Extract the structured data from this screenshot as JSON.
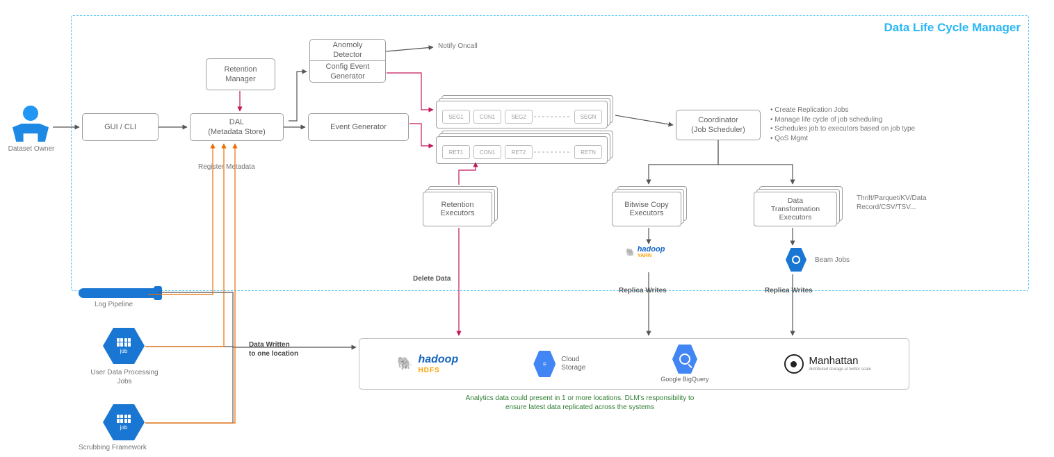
{
  "title": "Data Life Cycle Manager",
  "actor": "Dataset Owner",
  "boxes": {
    "gui": "GUI / CLI",
    "retention_mgr": "Retention\nManager",
    "dal": "DAL\n(Metadata Store)",
    "anomaly": "Anomoly\nDetector",
    "config_evt": "Config Event\nGenerator",
    "event_gen": "Event Generator",
    "coordinator": "Coordinator\n(Job Scheduler)",
    "ret_exec": "Retention\nExecutors",
    "bit_exec": "Bitwise Copy\nExecutors",
    "data_exec": "Data\nTransformation\nExecutors"
  },
  "mini": {
    "seg1": "SEG1",
    "con1": "CON1",
    "seg2": "SEG2",
    "segn": "SEGN",
    "ret1": "RET1",
    "con1b": "CON1",
    "ret2": "RET2",
    "retn": "RETN"
  },
  "labels": {
    "notify": "Notify Oncall",
    "register": "Register Metadata",
    "delete": "Delete Data",
    "replica1": "Replica Writes",
    "replica2": "Replica Writes",
    "beam": "Beam Jobs",
    "thrift": "Thrift/Parquet/KV/Data\nRecord/CSV/TSV...",
    "datawritten": "Data Written\nto one location",
    "logpipe": "Log Pipeline",
    "userjobs": "User Data Processing\nJobs",
    "scrubbing": "Scrubbing Framework",
    "footnote": "Analytics data could present in 1 or more locations. DLM's responsibility to\nensure latest data replicated across the systems",
    "job": "job"
  },
  "coord_bullets": [
    "Create Replication Jobs",
    "Manage life cycle of job scheduling",
    "Schedules job to executors based on job type",
    "QoS Mgmt"
  ],
  "storage": {
    "hdfs_name": "hadoop",
    "hdfs_sub": "HDFS",
    "gcs": "Cloud\nStorage",
    "bq": "Google BigQuery",
    "manhattan": "Manhattan",
    "manhattan_sub": "distributed storage at twitter scale",
    "yarn": "hadoop",
    "yarn_sub": "YARN"
  }
}
